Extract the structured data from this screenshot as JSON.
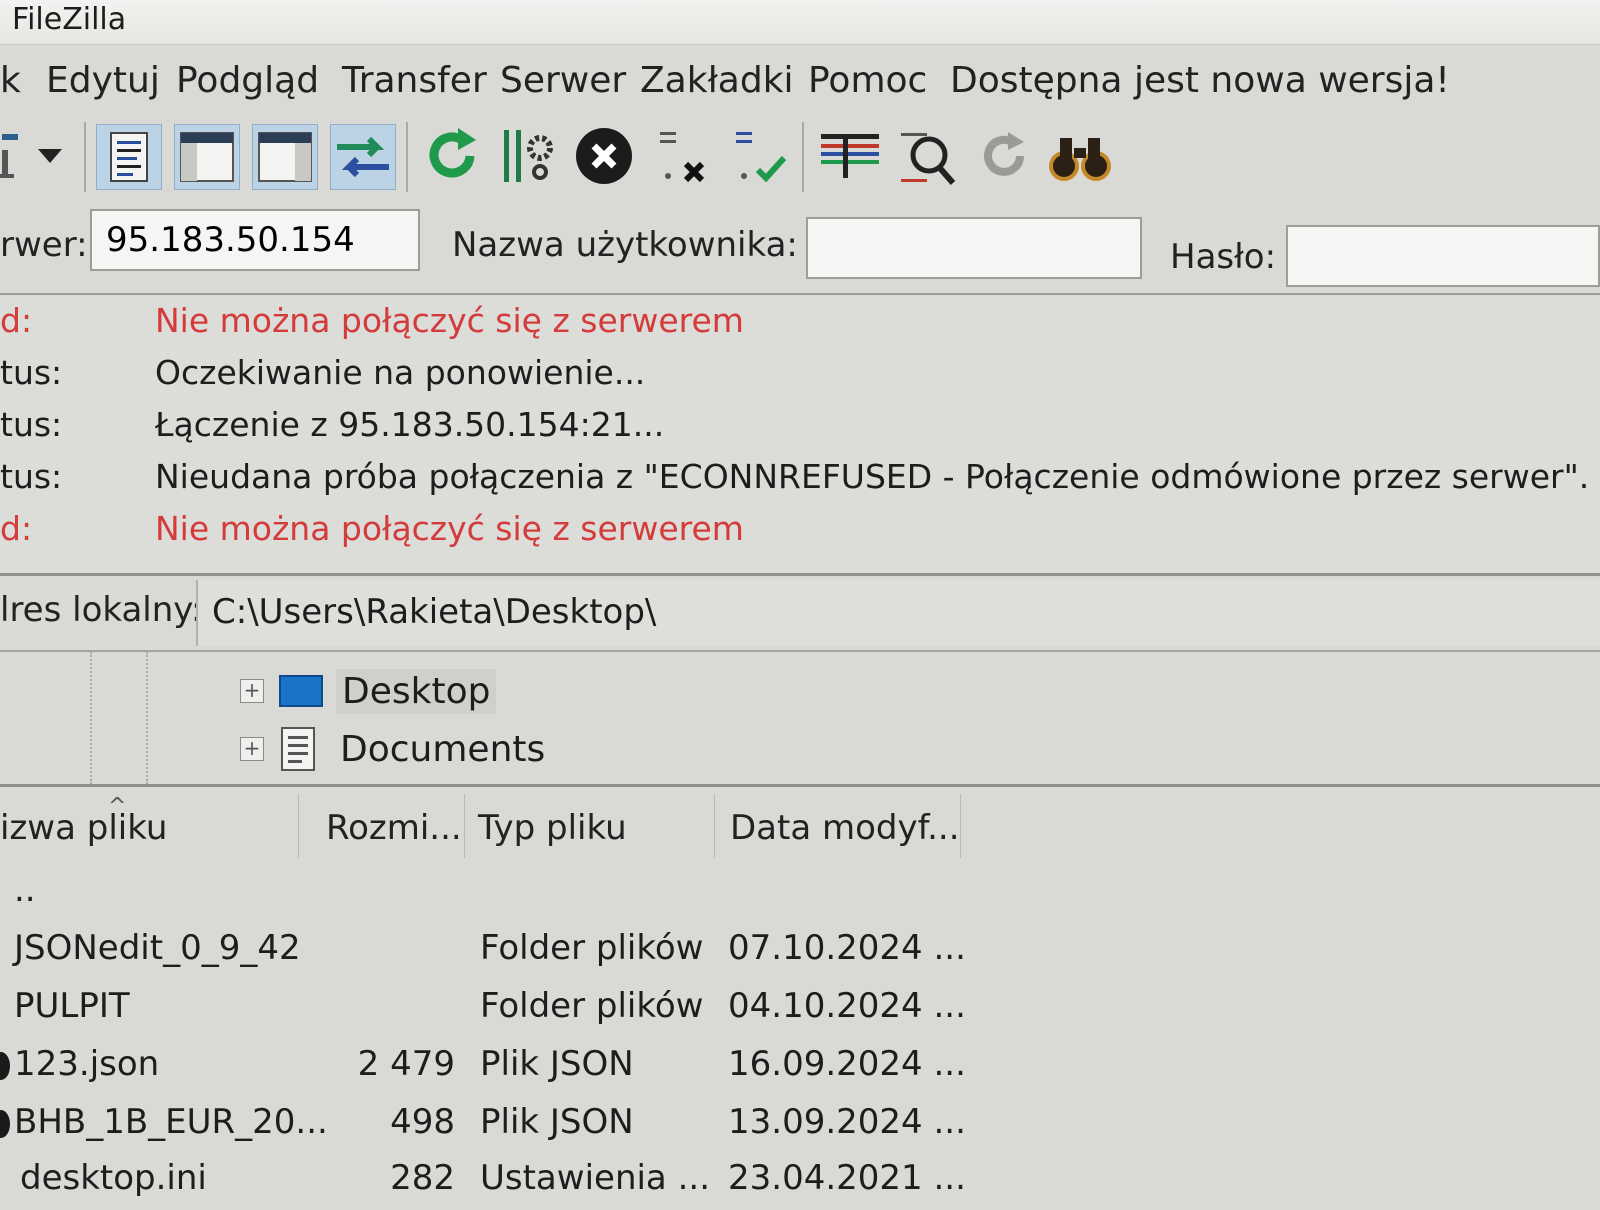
{
  "window": {
    "title": "FileZilla"
  },
  "menu": {
    "items": [
      "k",
      "Edytuj",
      "Podgląd",
      "Transfer",
      "Serwer",
      "Zakładki",
      "Pomoc",
      "Dostępna jest nowa wersja!"
    ]
  },
  "toolbar": {
    "icons": [
      "site-manager-icon",
      "dropdown-arrow-icon",
      "message-log-icon",
      "local-tree-icon",
      "remote-tree-icon",
      "transfer-queue-icon",
      "refresh-icon",
      "filter-icon",
      "cancel-icon",
      "disconnect-icon",
      "reconnect-icon",
      "directory-compare-icon",
      "search-icon",
      "sync-browse-icon",
      "find-files-icon"
    ]
  },
  "quickconnect": {
    "host_label": "rwer:",
    "host_value": "95.183.50.154",
    "user_label": "Nazwa użytkownika:",
    "user_value": "",
    "pass_label": "Hasło:",
    "pass_value": ""
  },
  "log": {
    "entries": [
      {
        "type": "d:",
        "message": "Nie można połączyć się z serwerem",
        "error": true
      },
      {
        "type": "tus:",
        "message": "Oczekiwanie na ponowienie...",
        "error": false
      },
      {
        "type": "tus:",
        "message": "Łączenie z 95.183.50.154:21...",
        "error": false
      },
      {
        "type": "tus:",
        "message": "Nieudana próba połączenia z \"ECONNREFUSED - Połączenie odmówione przez serwer\".",
        "error": false
      },
      {
        "type": "d:",
        "message": "Nie można połączyć się z serwerem",
        "error": true
      }
    ],
    "error_color": "#d43b3b"
  },
  "local": {
    "label": "lres lokalny:",
    "path": "C:\\Users\\Rakieta\\Desktop\\",
    "tree": [
      {
        "label": "Desktop",
        "icon": "desktop-folder-icon",
        "selected": true
      },
      {
        "label": "Documents",
        "icon": "documents-folder-icon",
        "selected": false
      }
    ]
  },
  "filelist": {
    "columns": [
      "izwa pliku",
      "Rozmi...",
      "Typ pliku",
      "Data modyf..."
    ],
    "rows": [
      {
        "name": "..",
        "size": "",
        "type": "",
        "date": ""
      },
      {
        "name": "JSONedit_0_9_42",
        "size": "",
        "type": "Folder plików",
        "date": "07.10.2024 ..."
      },
      {
        "name": "PULPIT",
        "size": "",
        "type": "Folder plików",
        "date": "04.10.2024 ..."
      },
      {
        "name": "123.json",
        "size": "2 479",
        "type": "Plik JSON",
        "date": "16.09.2024 ..."
      },
      {
        "name": "BHB_1B_EUR_20...",
        "size": "498",
        "type": "Plik JSON",
        "date": "13.09.2024 ..."
      },
      {
        "name": "desktop.ini",
        "size": "282",
        "type": "Ustawienia ...",
        "date": "23.04.2021 ..."
      }
    ]
  }
}
